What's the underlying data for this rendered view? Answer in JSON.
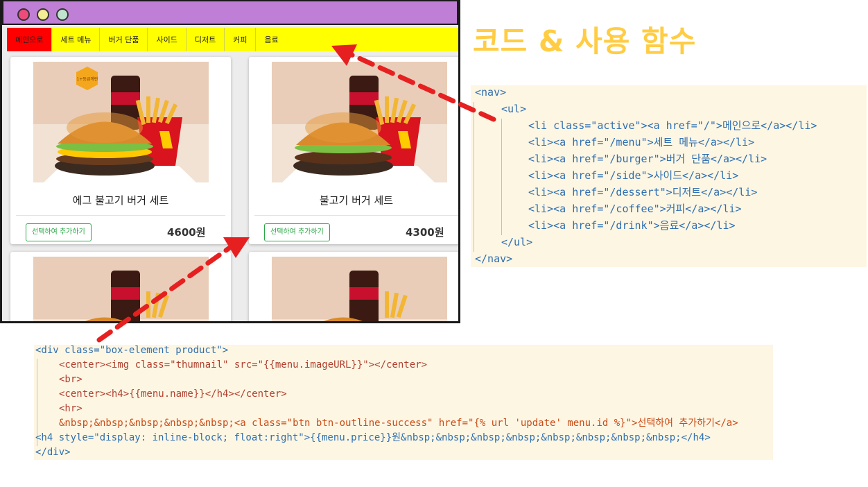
{
  "window": {
    "controls": [
      "close",
      "minimize",
      "maximize"
    ]
  },
  "nav": {
    "items": [
      {
        "label": "메인으로",
        "active": true
      },
      {
        "label": "세트 메뉴",
        "active": false
      },
      {
        "label": "버거 단품",
        "active": false
      },
      {
        "label": "사이드",
        "active": false
      },
      {
        "label": "디저트",
        "active": false
      },
      {
        "label": "커피",
        "active": false
      },
      {
        "label": "음료",
        "active": false
      }
    ]
  },
  "products": [
    {
      "name": "에그 불고기 버거 세트",
      "button": "선택하여 추가하기",
      "price": "4600원",
      "badge": "1+등급계란"
    },
    {
      "name": "불고기 버거 세트",
      "button": "선택하여 추가하기",
      "price": "4300원"
    }
  ],
  "heading": "코드 & 사용 함수",
  "nav_code": {
    "lines": [
      "<nav>",
      "<ul>",
      "<li class=\"active\"><a href=\"/\">메인으로</a></li>",
      "<li><a href=\"/menu\">세트 메뉴</a></li>",
      "<li><a href=\"/burger\">버거 단품</a></li>",
      "<li><a href=\"/side\">사이드</a></li>",
      "<li><a href=\"/dessert\">디저트</a></li>",
      "<li><a href=\"/coffee\">커피</a></li>",
      "<li><a href=\"/drink\">음료</a></li>",
      "</ul>",
      "</nav>"
    ]
  },
  "div_code": {
    "lines": [
      "<div class=\"box-element product\">",
      "<center><img class=\"thumnail\" src=\"{{menu.imageURL}}\"></center>",
      "<br>",
      "<center><h4>{{menu.name}}</h4></center>",
      "<hr>",
      "&nbsp;&nbsp;&nbsp;&nbsp;&nbsp;<a class=\"btn btn-outline-success\" href=\"{% url 'update' menu.id %}\">선택하여 추가하기</a>",
      "<h4 style=\"display: inline-block; float:right\">{{menu.price}}원&nbsp;&nbsp;&nbsp;&nbsp;&nbsp;&nbsp;&nbsp;&nbsp;</h4>",
      "</div>"
    ]
  },
  "colors": {
    "titlebar": "#c07fd6",
    "nav_bg": "#ffff00",
    "nav_active": "#ff0000",
    "heading": "#ffcc44",
    "code_bg": "#fdf6e3",
    "arrow": "#e62020",
    "button_outline": "#28a745"
  }
}
